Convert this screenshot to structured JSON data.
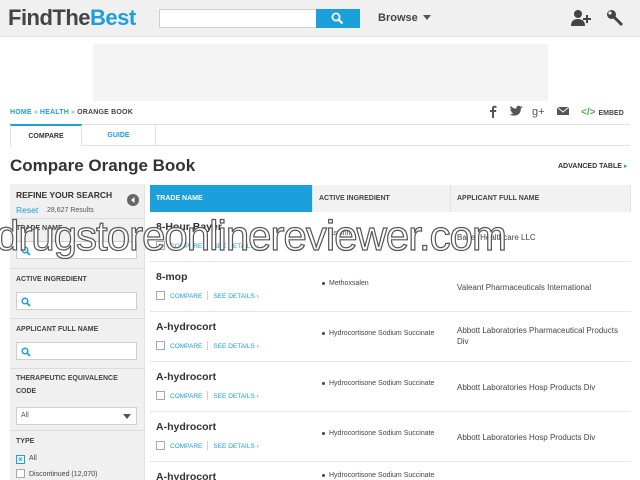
{
  "header": {
    "logo_prefix": "FindThe",
    "logo_suffix": "Best",
    "search_placeholder": "",
    "browse_label": "Browse"
  },
  "breadcrumb": {
    "home": "HOME",
    "health": "HEALTH",
    "current": "ORANGE BOOK"
  },
  "share": {
    "embed_label": "EMBED"
  },
  "tabs": [
    {
      "label": "COMPARE",
      "active": true
    },
    {
      "label": "GUIDE",
      "active": false
    }
  ],
  "page": {
    "title": "Compare Orange Book",
    "advanced_table": "ADVANCED TABLE"
  },
  "sidebar": {
    "title": "REFINE YOUR SEARCH",
    "reset": "Reset",
    "results": "28,627 Results",
    "filters": {
      "trade_name": "TRADE NAME",
      "active_ingredient": "ACTIVE INGREDIENT",
      "applicant": "APPLICANT FULL NAME",
      "te_code": "THERAPEUTIC EQUIVALENCE CODE",
      "te_selected": "All",
      "type": "TYPE",
      "type_all": "All",
      "type_discontinued": "Discontinued (12,070)"
    }
  },
  "table": {
    "columns": [
      "TRADE NAME",
      "ACTIVE INGREDIENT",
      "APPLICANT FULL NAME"
    ],
    "compare_label": "COMPARE",
    "details_label": "SEE DETAILS",
    "rows": [
      {
        "name": "8-Hour Bayer",
        "ingredient": "Aspirin",
        "applicant": "Bayer Healthcare LLC"
      },
      {
        "name": "8-mop",
        "ingredient": "Methoxsalen",
        "applicant": "Valeant Pharmaceuticals International"
      },
      {
        "name": "A-hydrocort",
        "ingredient": "Hydrocortisone Sodium Succinate",
        "applicant": "Abbott Laboratories Pharmaceutical Products Div"
      },
      {
        "name": "A-hydrocort",
        "ingredient": "Hydrocortisone Sodium Succinate",
        "applicant": "Abbott Laboratories Hosp Products Div"
      },
      {
        "name": "A-hydrocort",
        "ingredient": "Hydrocortisone Sodium Succinate",
        "applicant": "Abbott Laboratories Hosp Products Div"
      },
      {
        "name": "A-hydrocort",
        "ingredient": "Hydrocortisone Sodium Succinate",
        "applicant": ""
      }
    ]
  },
  "watermark": "drugstoreonlinereviewer.com",
  "colors": {
    "accent": "#1ba0db",
    "header_bg": "#f0f0f0",
    "sidebar_bg": "#f0f0f0"
  }
}
